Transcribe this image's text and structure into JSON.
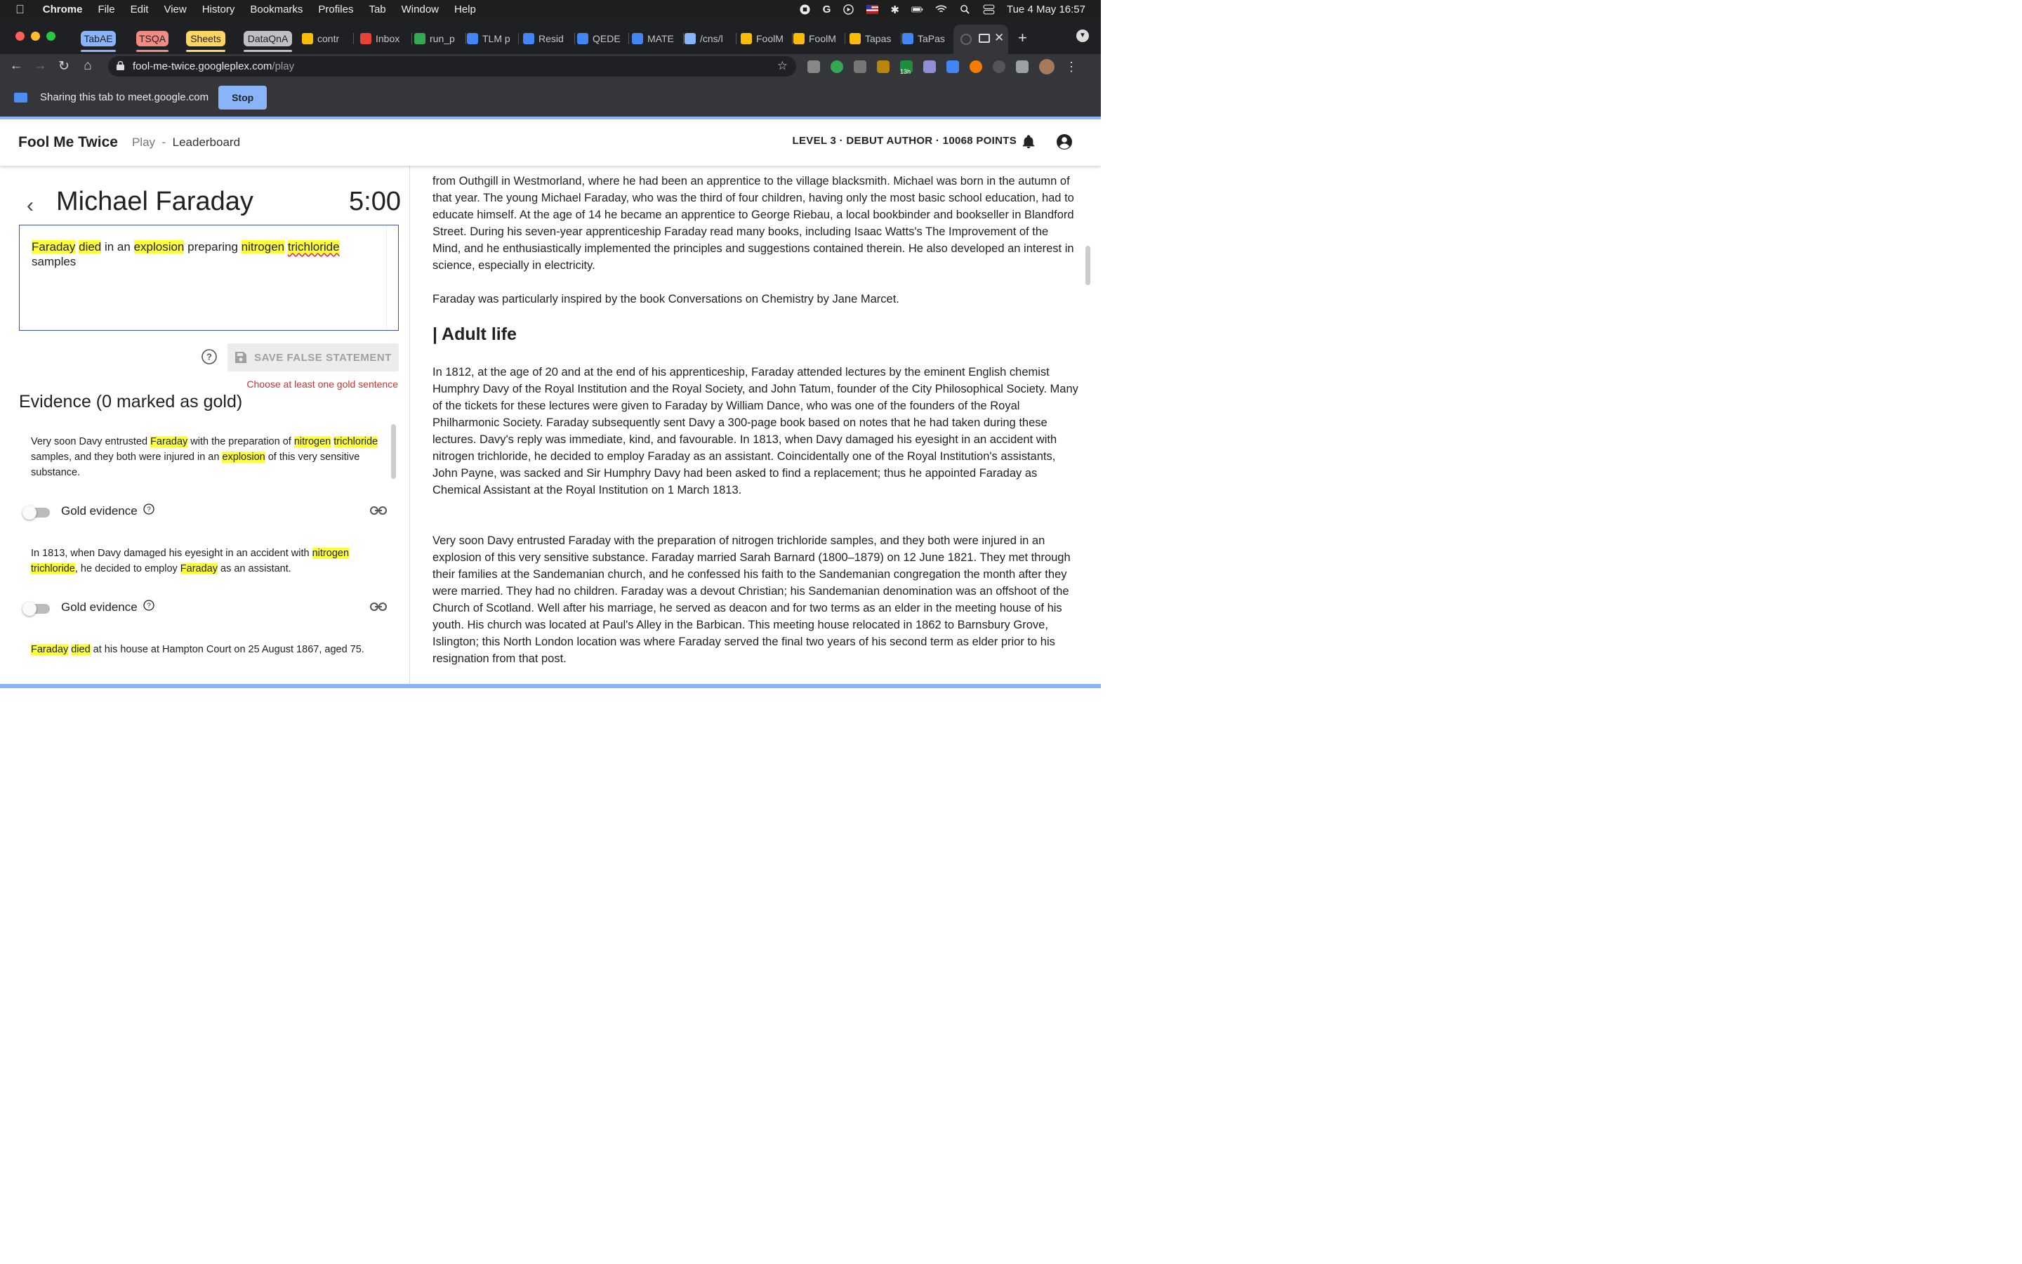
{
  "menubar": {
    "app": "Chrome",
    "items": [
      "File",
      "Edit",
      "View",
      "History",
      "Bookmarks",
      "Profiles",
      "Tab",
      "Window",
      "Help"
    ],
    "datetime": "Tue 4 May  16:57"
  },
  "tab_groups": [
    {
      "label": "TabAE",
      "color": "#8ab4f8"
    },
    {
      "label": "TSQA",
      "color": "#f28b82"
    },
    {
      "label": "Sheets",
      "color": "#fdd663"
    },
    {
      "label": "DataQnA",
      "color": "#bdc1c6"
    }
  ],
  "tabs": [
    {
      "title": "contr",
      "icon": "note-icon",
      "color": "#fbbc04"
    },
    {
      "title": "Inbox",
      "icon": "gmail-icon",
      "color": "#ea4335"
    },
    {
      "title": "run_p",
      "icon": "check-icon",
      "color": "#34a853"
    },
    {
      "title": "TLM p",
      "icon": "docs-icon",
      "color": "#4285f4"
    },
    {
      "title": "Resid",
      "icon": "docs-icon",
      "color": "#4285f4"
    },
    {
      "title": "QEDE",
      "icon": "docs-icon",
      "color": "#4285f4"
    },
    {
      "title": "MATE",
      "icon": "docs-icon",
      "color": "#4285f4"
    },
    {
      "title": "/cns/l",
      "icon": "cns-icon",
      "color": "#8ab4f8"
    },
    {
      "title": "FoolM",
      "icon": "slides-icon",
      "color": "#fbbc04"
    },
    {
      "title": "FoolM",
      "icon": "slides-icon",
      "color": "#fbbc04"
    },
    {
      "title": "Tapas",
      "icon": "slides-icon",
      "color": "#fbbc04"
    },
    {
      "title": "TaPas",
      "icon": "docs-icon",
      "color": "#4285f4"
    }
  ],
  "address": {
    "host": "fool-me-twice.googleplex.com",
    "path": "/play"
  },
  "share": {
    "text": "Sharing this tab to meet.google.com",
    "stop": "Stop"
  },
  "extension_badge": "13h",
  "header": {
    "brand": "Fool Me Twice",
    "play": "Play",
    "sep": "-",
    "leaderboard": "Leaderboard",
    "level": "LEVEL 3 · DEBUT AUTHOR · 10068 POINTS"
  },
  "game": {
    "title": "Michael Faraday",
    "timer": "5:00",
    "statement": {
      "w1": "Faraday",
      "w2": "died",
      "t1": " in an ",
      "w3": "explosion",
      "t2": " preparing ",
      "w4": "nitrogen",
      "t3": " ",
      "w5": "trichloride",
      "t4": " samples"
    },
    "save_label": "SAVE FALSE STATEMENT",
    "error": "Choose at least one gold sentence",
    "evidence_heading": "Evidence (0 marked as gold)",
    "gold_label": "Gold evidence"
  },
  "evidence": [
    {
      "a": "Very soon Davy entrusted ",
      "b": "Faraday",
      "c": " with the preparation of ",
      "d": "nitrogen",
      "e": " ",
      "f": "trichloride",
      "g": " samples, and they both were injured in an ",
      "h": "explosion",
      "i": " of this very sensitive substance."
    },
    {
      "a": "In 1813, when Davy damaged his eyesight in an accident with ",
      "b": "nitrogen",
      "c": " ",
      "d": "trichloride",
      "e": ", he decided to employ ",
      "f": "Faraday",
      "g": " as an assistant."
    },
    {
      "a": "Faraday",
      "b": " ",
      "c": "died",
      "d": " at his house at Hampton Court on 25 August 1867, aged 75."
    }
  ],
  "article": {
    "p0": "from Outhgill in Westmorland, where he had been an apprentice to the village blacksmith. Michael was born in the autumn of that year. The young Michael Faraday, who was the third of four children, having only the most basic school education, had to educate himself. At the age of 14 he became an apprentice to George Riebau, a local bookbinder and bookseller in Blandford Street. During his seven-year apprenticeship Faraday read many books, including Isaac Watts's The Improvement of the Mind, and he enthusiastically implemented the principles and suggestions contained therein. He also developed an interest in science, especially in electricity.",
    "p1": "Faraday was particularly inspired by the book Conversations on Chemistry by Jane Marcet.",
    "heading": "| Adult life",
    "p2": "In 1812, at the age of 20 and at the end of his apprenticeship, Faraday attended lectures by the eminent English chemist Humphry Davy of the Royal Institution and the Royal Society, and John Tatum, founder of the City Philosophical Society. Many of the tickets for these lectures were given to Faraday by William Dance, who was one of the founders of the Royal Philharmonic Society. Faraday subsequently sent Davy a 300-page book based on notes that he had taken during these lectures. Davy's reply was immediate, kind, and favourable. In 1813, when Davy damaged his eyesight in an accident with nitrogen trichloride, he decided to employ Faraday as an assistant. Coincidentally one of the Royal Institution's assistants, John Payne, was sacked and Sir Humphry Davy had been asked to find a replacement; thus he appointed Faraday as Chemical Assistant at the Royal Institution on 1 March 1813.",
    "p3": "Very soon Davy entrusted Faraday with the preparation of nitrogen trichloride samples, and they both were injured in an explosion of this very sensitive substance. Faraday married Sarah Barnard (1800–1879) on 12 June 1821. They met through their families at the Sandemanian church, and he confessed his faith to the Sandemanian congregation the month after they were married. They had no children. Faraday was a devout Christian; his Sandemanian denomination was an offshoot of the Church of Scotland. Well after his marriage, he served as deacon and for two terms as an elder in the meeting house of his youth. His church was located at Paul's Alley in the Barbican. This meeting house relocated in 1862 to Barnsbury Grove, Islington; this North London location was where Faraday served the final two years of his second term as elder prior to his resignation from that post."
  }
}
